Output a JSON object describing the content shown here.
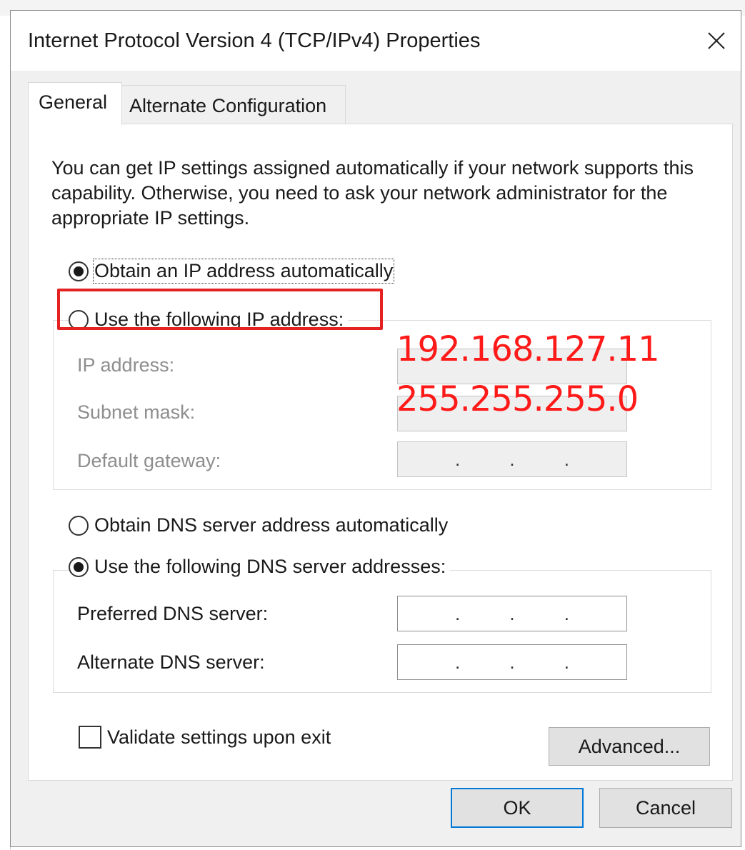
{
  "window": {
    "title": "Internet Protocol Version 4 (TCP/IPv4) Properties"
  },
  "tabs": [
    {
      "label": "General",
      "active": true
    },
    {
      "label": "Alternate Configuration",
      "active": false
    }
  ],
  "intro_text": "You can get IP settings assigned automatically if your network supports this capability. Otherwise, you need to ask your network administrator for the appropriate IP settings.",
  "ip_mode": {
    "auto_label": "Obtain an IP address automatically",
    "manual_label": "Use the following IP address:",
    "selected": "auto"
  },
  "ip_fields": {
    "ip_address_label": "IP address:",
    "subnet_mask_label": "Subnet mask:",
    "default_gateway_label": "Default gateway:",
    "empty_dots": [
      ".",
      ".",
      "."
    ]
  },
  "annotations": {
    "ip_value": "192.168.127.11",
    "subnet_value": "255.255.255.0",
    "highlight_color": "#e52222",
    "text_color": "#ff1a1a"
  },
  "dns_mode": {
    "auto_label": "Obtain DNS server address automatically",
    "manual_label": "Use the following DNS server addresses:",
    "selected": "manual"
  },
  "dns_fields": {
    "preferred_label": "Preferred DNS server:",
    "alternate_label": "Alternate DNS server:"
  },
  "validate": {
    "label": "Validate settings upon exit",
    "checked": false
  },
  "buttons": {
    "advanced": "Advanced...",
    "ok": "OK",
    "cancel": "Cancel"
  },
  "icons": {
    "close": "close-icon"
  },
  "colors": {
    "accent": "#0078d7",
    "disabled_text": "#8e8e8e"
  }
}
